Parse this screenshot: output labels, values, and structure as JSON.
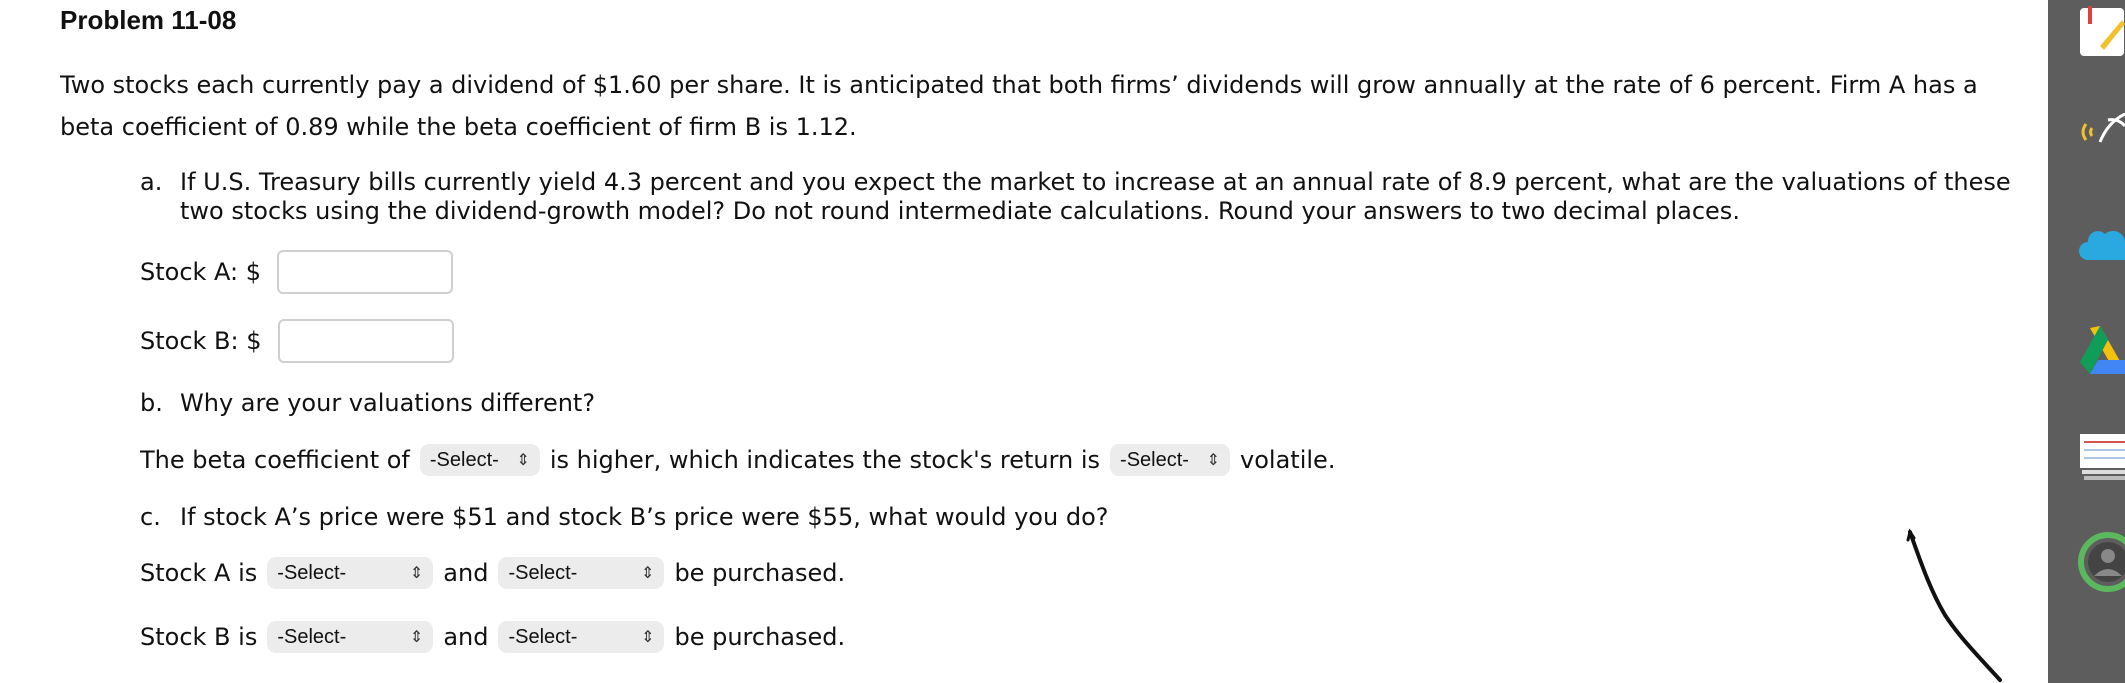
{
  "problem": {
    "title": "Problem 11-08",
    "intro": "Two stocks each currently pay a dividend of $1.60 per share. It is anticipated that both firms’ dividends will grow annually at the rate of 6 percent. Firm A has a beta coefficient of 0.89 while the beta coefficient of firm B is 1.12."
  },
  "part_a": {
    "marker": "a.",
    "question": "If U.S. Treasury bills currently yield 4.3 percent and you expect the market to increase at an annual rate of 8.9 percent, what are the valuations of these two stocks using the dividend-growth model? Do not round intermediate calculations. Round your answers to two decimal places.",
    "stock_a_label": "Stock A: $",
    "stock_a_value": "",
    "stock_b_label": "Stock B: $",
    "stock_b_value": ""
  },
  "part_b": {
    "marker": "b.",
    "question": "Why are your valuations different?",
    "sentence_start": "The beta coefficient of",
    "select1": "-Select-",
    "sentence_mid": "is higher, which indicates the stock's return is",
    "select2": "-Select-",
    "sentence_end": "volatile."
  },
  "part_c": {
    "marker": "c.",
    "question": "If stock A’s price were $51 and stock B’s price were $55, what would you do?",
    "row_a_label": "Stock A is",
    "row_a_select1": "-Select-",
    "and_label": "and",
    "row_a_select2": "-Select-",
    "end_label": "be purchased.",
    "row_b_label": "Stock B is",
    "row_b_select1": "-Select-",
    "row_b_select2": "-Select-"
  },
  "sidebar": {
    "icons": [
      "notes-pen-icon",
      "broadcast-hand-icon",
      "cloud-icon",
      "drive-icon",
      "index-cards-icon",
      "profile-ring-icon"
    ]
  }
}
